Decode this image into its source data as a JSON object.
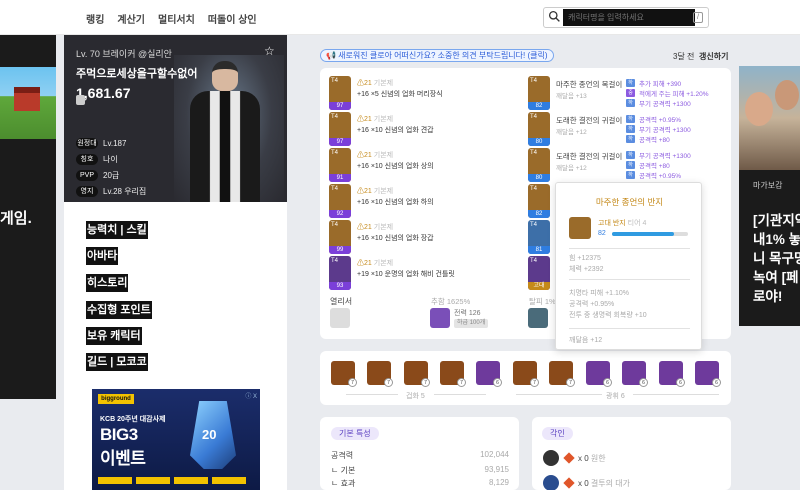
{
  "nav": {
    "links": [
      "랭킹",
      "계산기",
      "멀티서치",
      "떠돌이 상인"
    ]
  },
  "search": {
    "placeholder": "캐릭터명을 입력하세요",
    "kbd": "/"
  },
  "left_ad": {
    "text": "게임."
  },
  "profile": {
    "level_line": "Lv. 70 브레이커 @실리안",
    "name": "주먹으로세상을구할수없어",
    "power": "1,681.67",
    "info": [
      {
        "label": "원정대",
        "value": "Lv.187"
      },
      {
        "label": "칭호",
        "value": "나이"
      },
      {
        "label": "PVP",
        "value": "20급"
      },
      {
        "label": "영지",
        "value": "Lv.28 우리집"
      }
    ]
  },
  "menu": {
    "items": [
      "능력치 | 스킬",
      "아바타",
      "히스토리",
      "수집형 포인트",
      "보유 캐릭터",
      "길드 | 모코코"
    ],
    "ad": {
      "logo": "bigground",
      "line1": "KCB 20주년 대감사제",
      "line2": "BIG3",
      "line3": "이벤트",
      "trophy": "20",
      "badge": "ⓘ X"
    }
  },
  "notice": "📢 새로워진 클로아 어떠신가요? 소중한 의견 부탁드립니다! (클릭)",
  "updated": "3달 전",
  "refresh": "갱신하기",
  "equipment": {
    "armor": [
      {
        "tier": "T4",
        "quality": "97",
        "enh": "⚠21",
        "elx": "기본제",
        "name": "+16 ×5 신념의 업화 머리장식"
      },
      {
        "tier": "T4",
        "quality": "97",
        "enh": "⚠21",
        "elx": "기본제",
        "name": "+16 ×10 신념의 업화 견갑"
      },
      {
        "tier": "T4",
        "quality": "91",
        "enh": "⚠21",
        "elx": "기본제",
        "name": "+16 ×10 신념의 업화 상의"
      },
      {
        "tier": "T4",
        "quality": "92",
        "enh": "⚠21",
        "elx": "기본제",
        "name": "+16 ×10 신념의 업화 하의"
      },
      {
        "tier": "T4",
        "quality": "99",
        "enh": "⚠21",
        "elx": "기본제",
        "name": "+16 ×10 신념의 업화 장갑"
      },
      {
        "tier": "T4",
        "quality": "93",
        "enh": "⚠21",
        "elx": "기본제",
        "name": "+19 ×10 운명의 업화 해비 건틀릿"
      }
    ],
    "accessories": [
      {
        "tier": "T4",
        "quality": "82",
        "title": "마주한 종언의 목걸이",
        "sub": "깨달음 +13",
        "opts": [
          {
            "b": "하",
            "t": "추가 피해 +390"
          },
          {
            "b": "중",
            "t": "적에게 주는 피해 +1.20%"
          },
          {
            "b": "하",
            "t": "무기 공격력 +1300"
          }
        ]
      },
      {
        "tier": "T4",
        "quality": "80",
        "title": "도래한 결전의 귀걸이",
        "sub": "깨달음 +12",
        "opts": [
          {
            "b": "하",
            "t": "공격력 +0.95%"
          },
          {
            "b": "하",
            "t": "무기 공격력 +1300"
          },
          {
            "b": "하",
            "t": "공격력 +80"
          }
        ]
      },
      {
        "tier": "T4",
        "quality": "80",
        "title": "도래한 결전의 귀걸이",
        "sub": "깨달음 +12",
        "opts": [
          {
            "b": "하",
            "t": "무기 공격력 +1300"
          },
          {
            "b": "하",
            "t": "공격력 +80"
          },
          {
            "b": "하",
            "t": "공격력 +0.95%"
          }
        ]
      },
      {
        "tier": "T4",
        "quality": "82",
        "title": "",
        "sub": "",
        "opts": []
      },
      {
        "tier": "T4",
        "quality": "81",
        "title": "",
        "sub": "",
        "opts": []
      },
      {
        "tier": "T4",
        "quality": "고대",
        "title": "",
        "sub": "",
        "opts": []
      }
    ],
    "bracelet_label": "팔찌",
    "bracelet": "열리서",
    "stone_label": "추함 1625%",
    "stone_text": "전력 126",
    "stone_chip": "하급 100개",
    "relic_label": "탈피 1%"
  },
  "tooltip": {
    "title": "마주한 종언의 반지",
    "grade": "고대 반지",
    "tier": "티어 4",
    "quality": "82",
    "quality_pct": 82,
    "lines": [
      "힘 +12375",
      "체력 +2392",
      "치명타 피해 +1.10%",
      "공격력 +0.95%",
      "전투 중 생명력 회복량 +10",
      "깨달음 +12"
    ]
  },
  "gems": {
    "items": [
      {
        "lv": "7",
        "type": "o"
      },
      {
        "lv": "7",
        "type": "o"
      },
      {
        "lv": "7",
        "type": "o"
      },
      {
        "lv": "7",
        "type": "o"
      },
      {
        "lv": "6",
        "type": "p"
      },
      {
        "lv": "7",
        "type": "o"
      },
      {
        "lv": "7",
        "type": "o"
      },
      {
        "lv": "6",
        "type": "p"
      },
      {
        "lv": "6",
        "type": "p"
      },
      {
        "lv": "6",
        "type": "p"
      },
      {
        "lv": "6",
        "type": "p"
      }
    ],
    "label_left": "겁화 5",
    "label_right": "광휘 6"
  },
  "basic": {
    "tab": "기본 특성",
    "rows": [
      {
        "k": "공격력",
        "v": "102,044"
      },
      {
        "k": "ㄴ 기본",
        "v": "93,915"
      },
      {
        "k": "ㄴ 효과",
        "v": "8,129"
      }
    ]
  },
  "engrave": {
    "tab": "각인",
    "rows": [
      {
        "x": "x",
        "n": "0",
        "name": "원한"
      },
      {
        "x": "x",
        "n": "0",
        "name": "결투의 대가"
      }
    ]
  },
  "right_ad": {
    "caption": "마가보감",
    "lines": [
      "[기관지약",
      "내1% 놓",
      "니 목구멍",
      "녹여 [페",
      "로야!"
    ]
  }
}
